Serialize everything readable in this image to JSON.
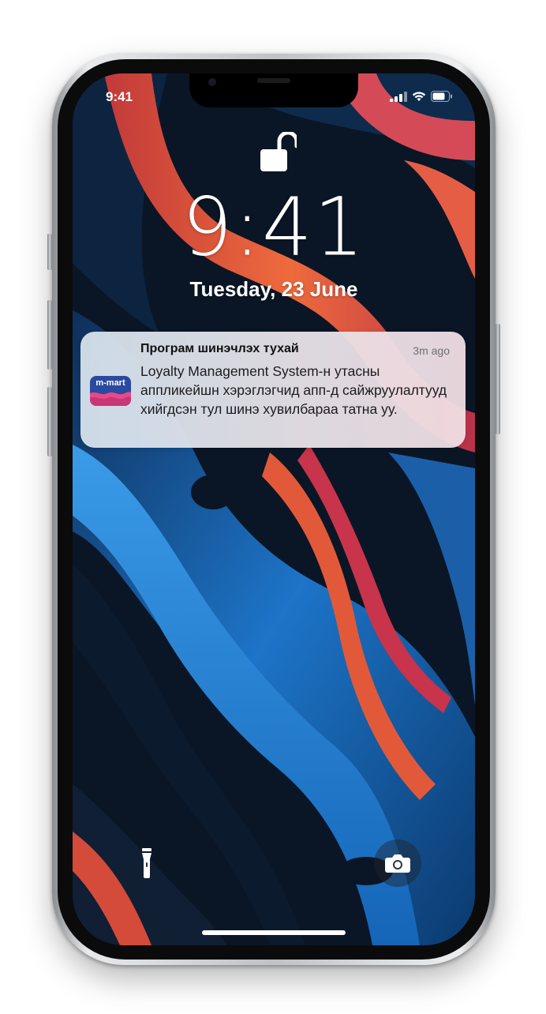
{
  "status_bar": {
    "time": "9:41",
    "icons": [
      "cellular-signal-icon",
      "wifi-icon",
      "battery-icon"
    ]
  },
  "lock_screen": {
    "lock_icon": "unlocked-padlock-icon",
    "time": "9:41",
    "date": "Tuesday,  23 June"
  },
  "notification": {
    "app_icon": {
      "label": "m-mart",
      "colors": {
        "background": "#2a4aa0",
        "wave_pink": "#e84a87"
      }
    },
    "title": "Програм шинэчлэх тухай",
    "time": "3m ago",
    "body": "Loyalty Management System-н утасны аппликейшн хэрэглэгчид апп-д сайжруулалтууд хийгдсэн тул шинэ хувилбараа татна уу."
  },
  "bottom_controls": {
    "left": "flashlight-icon",
    "right": "camera-icon"
  },
  "colors": {
    "frame": "#c9cbce",
    "wallpaper_dark": "#0a1626",
    "wallpaper_blue": "#1d74c8",
    "wallpaper_orange": "#e2593a",
    "wallpaper_red": "#b8324a"
  }
}
